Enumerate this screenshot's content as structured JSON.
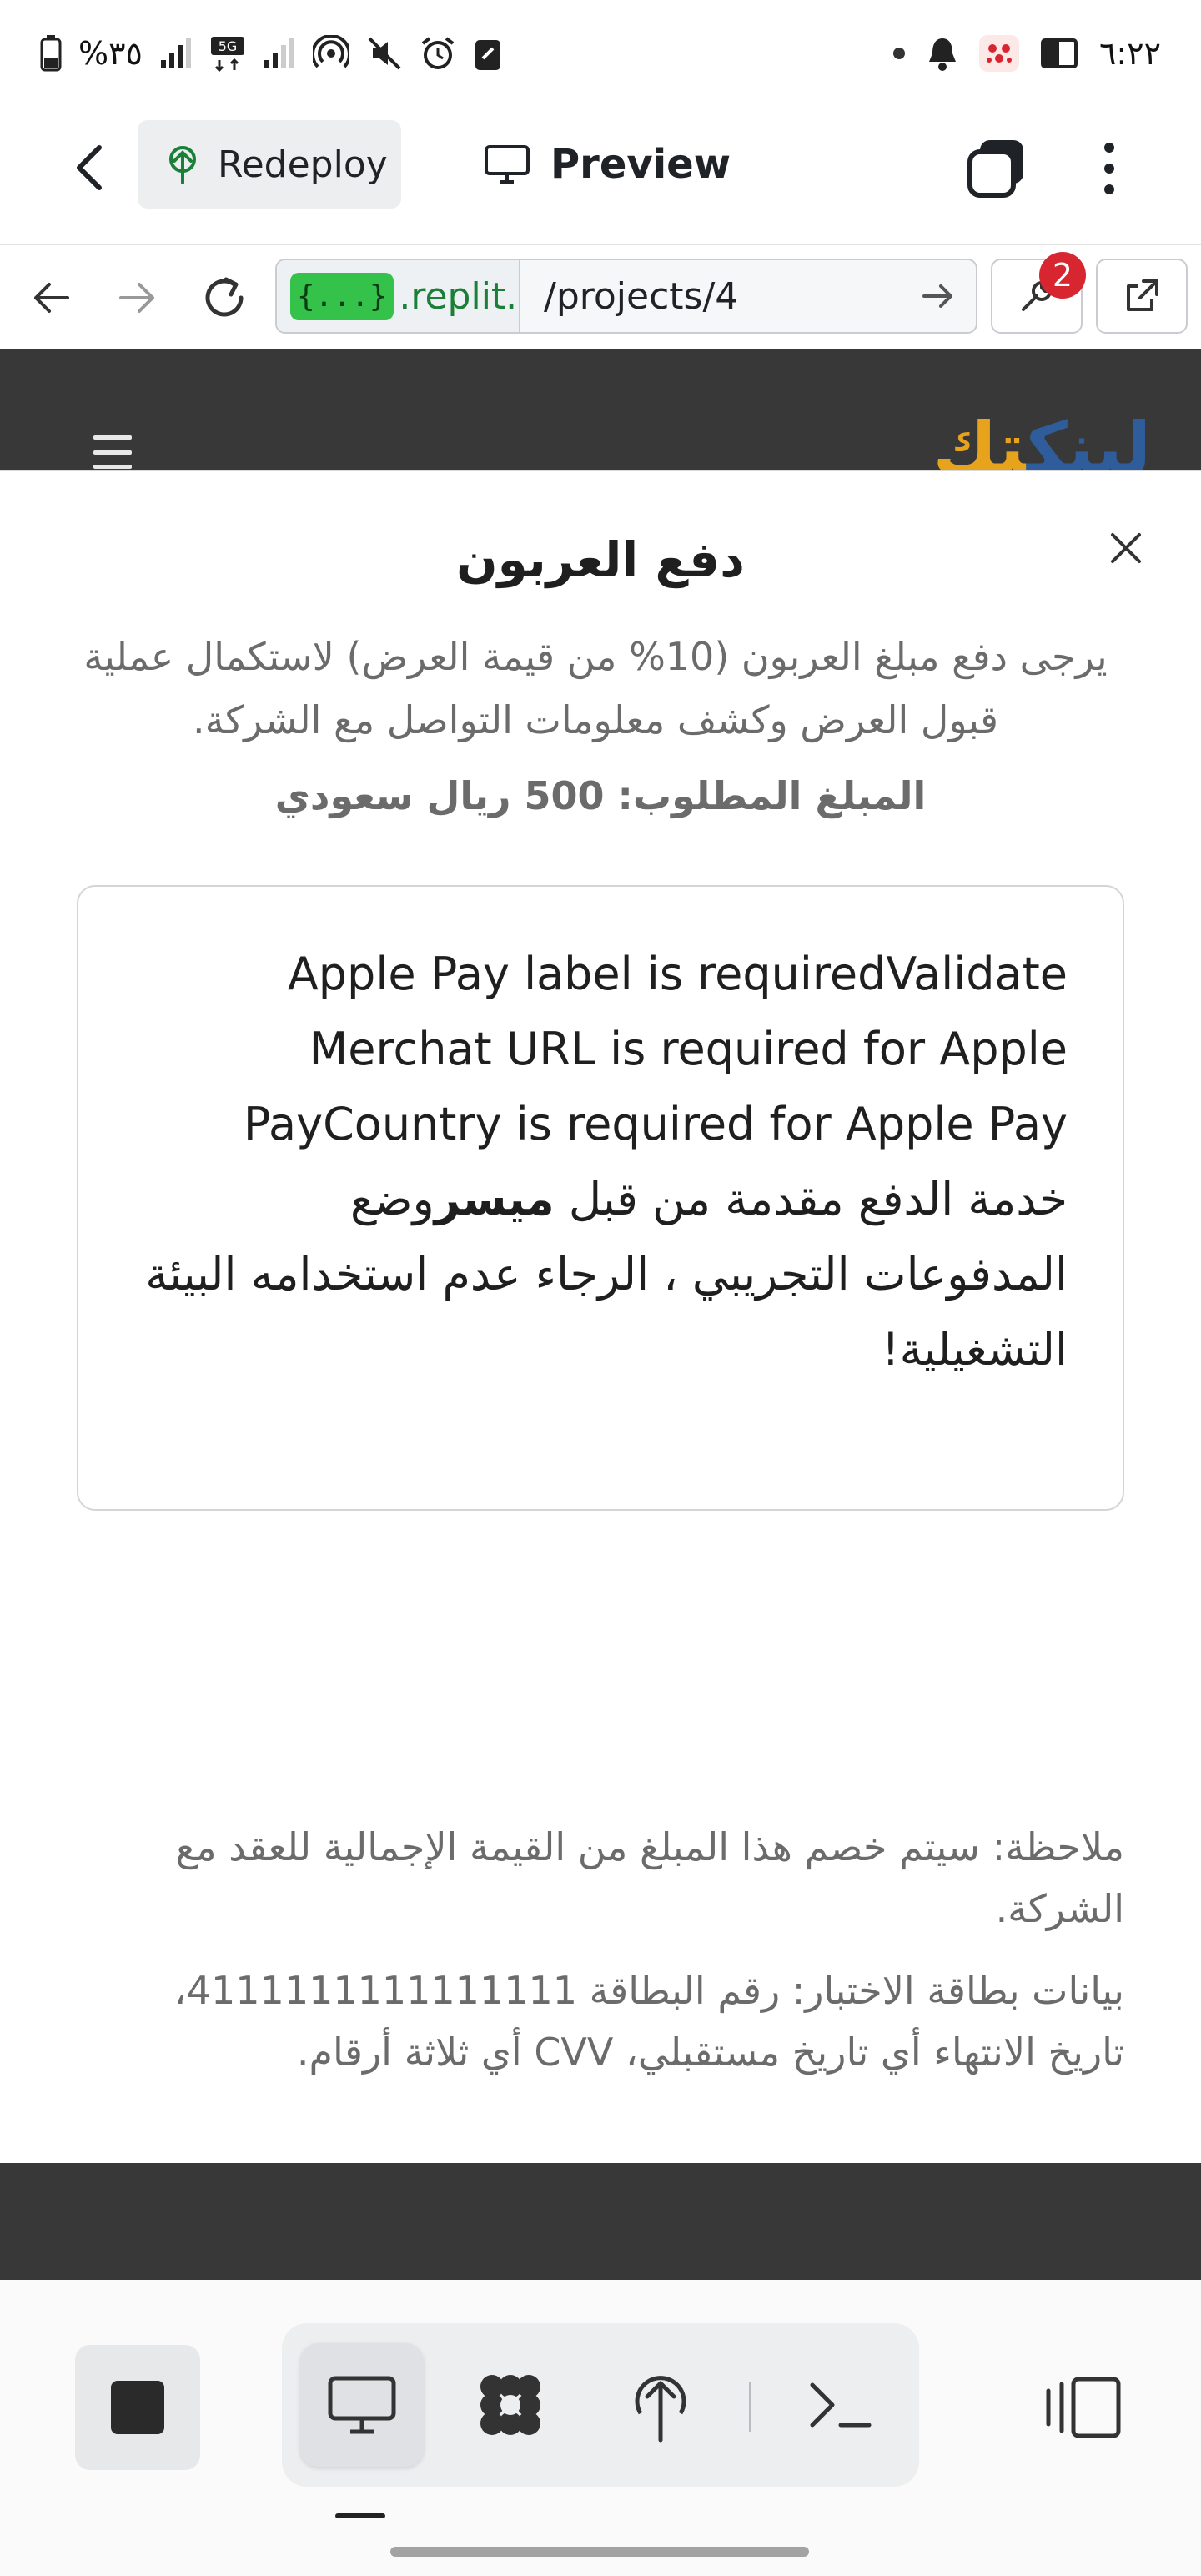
{
  "status_bar": {
    "battery_percent": "%٣٥",
    "network_label": "5G",
    "time": "٦:٢٢"
  },
  "app_header": {
    "redeploy_label": "Redeploy",
    "preview_label": "Preview"
  },
  "url_bar": {
    "domain_badge": "{...}",
    "domain_text": ".replit.de",
    "path": "/projects/4",
    "devtools_badge_count": "2"
  },
  "site": {
    "logo_part1": "لينك",
    "logo_part2": "تك"
  },
  "modal": {
    "title": "دفع العربون",
    "description": "يرجى دفع مبلغ العربون (10% من قيمة العرض) لاستكمال عملية قبول العرض وكشف معلومات التواصل مع الشركة.",
    "amount": "المبلغ المطلوب: 500 ريال سعودي",
    "payment_error": "Apple Pay label is requiredValidate Merchat URL is required for Apple PayCountry is required for Apple Pay",
    "notice_prefix": "خدمة الدفع مقدمة من قبل ",
    "notice_brand": "ميسر",
    "notice_suffix": "وضع المدفوعات التجريبي ، الرجاء عدم استخدامه البيئة التشغيلية!",
    "note": "ملاحظة: سيتم خصم هذا المبلغ من القيمة الإجمالية للعقد مع الشركة.",
    "test_card": "بيانات بطاقة الاختبار: رقم البطاقة 4111111111111111، تاريخ الانتهاء أي تاريخ مستقبلي، CVV أي ثلاثة أرقام."
  },
  "icons": {
    "back": "chevron-left-icon",
    "redeploy": "deploy-icon",
    "preview": "monitor-icon",
    "tabs": "tabs-icon",
    "more": "kebab-icon",
    "close": "close-icon",
    "stop": "stop-icon",
    "console": "terminal-icon"
  },
  "colors": {
    "url_badge_green": "#35c24a",
    "domain_green": "#1a7f37",
    "badge_red": "#d7262f",
    "site_dark": "#383838",
    "logo_orange": "#e7a31b",
    "logo_blue": "#2f5c9a"
  }
}
